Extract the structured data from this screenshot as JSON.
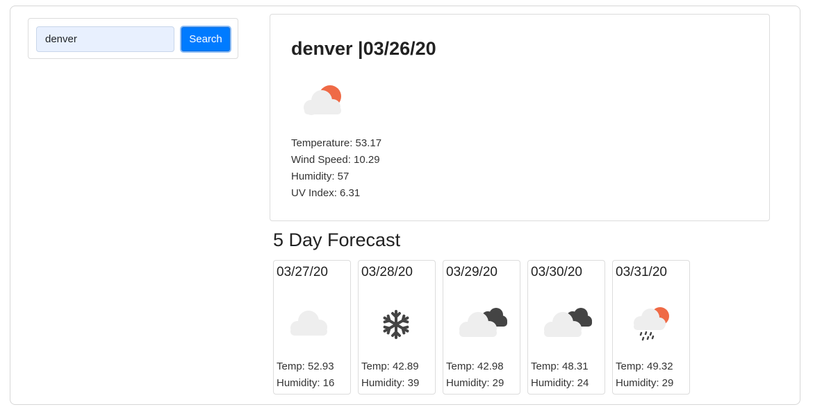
{
  "search": {
    "value": "denver",
    "button_label": "Search"
  },
  "current": {
    "title": "denver |03/26/20",
    "icon": "cloud-with-sun-icon",
    "temperature": "Temperature: 53.17",
    "wind": "Wind Speed: 10.29",
    "humidity": "Humidity: 57",
    "uv": "UV Index: 6.31"
  },
  "forecast_heading": "5 Day Forecast",
  "forecast": [
    {
      "date": "03/27/20",
      "icon": "cloud-icon",
      "temp": "Temp: 52.93",
      "humidity": "Humidity: 16"
    },
    {
      "date": "03/28/20",
      "icon": "snowflake-icon",
      "temp": "Temp: 42.89",
      "humidity": "Humidity: 39"
    },
    {
      "date": "03/29/20",
      "icon": "dark-clouds-icon",
      "temp": "Temp: 42.98",
      "humidity": "Humidity: 29"
    },
    {
      "date": "03/30/20",
      "icon": "dark-clouds-icon",
      "temp": "Temp: 48.31",
      "humidity": "Humidity: 24"
    },
    {
      "date": "03/31/20",
      "icon": "rain-cloud-sun-icon",
      "temp": "Temp: 49.32",
      "humidity": "Humidity: 29"
    }
  ],
  "colors": {
    "accent": "#007bff",
    "sun": "#ef6a46",
    "cloud": "#eeeeee",
    "dark_cloud": "#444444"
  }
}
